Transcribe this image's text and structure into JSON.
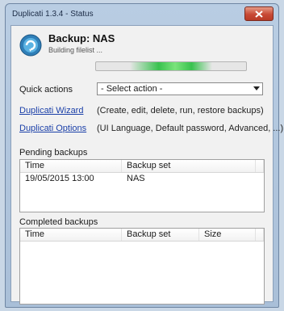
{
  "window": {
    "title": "Duplicati 1.3.4 - Status"
  },
  "header": {
    "backup_title": "Backup: NAS",
    "status_text": "Building filelist ...",
    "progress_fraction": 0.55
  },
  "quick_actions": {
    "label": "Quick actions",
    "selected": "- Select action -"
  },
  "links": [
    {
      "label": "Duplicati Wizard",
      "description": "(Create, edit, delete, run, restore backups)"
    },
    {
      "label": "Duplicati Options",
      "description": "(UI Language, Default password, Advanced, ...)"
    }
  ],
  "pending": {
    "label": "Pending backups",
    "columns": [
      "Time",
      "Backup set"
    ],
    "rows": [
      [
        "19/05/2015 13:00",
        "NAS"
      ]
    ]
  },
  "completed": {
    "label": "Completed backups",
    "columns": [
      "Time",
      "Backup set",
      "Size"
    ],
    "rows": []
  },
  "colors": {
    "accent": "#1a3fa8",
    "progress": "#39c24f",
    "close": "#c84a35"
  }
}
